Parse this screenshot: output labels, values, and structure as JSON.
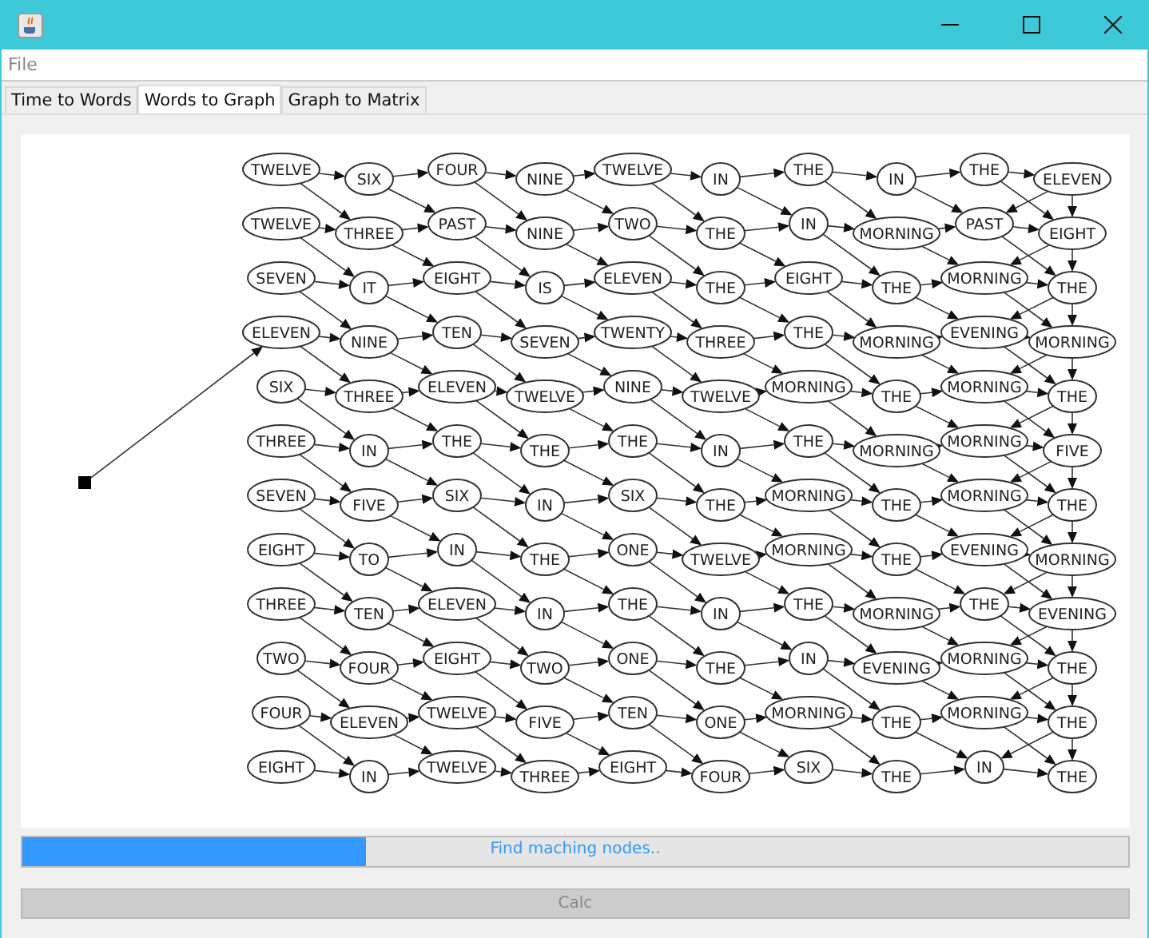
{
  "menu": [
    "File"
  ],
  "tabs": [
    {
      "label": "Time to Words",
      "selected": false
    },
    {
      "label": "Words to Graph",
      "selected": true
    },
    {
      "label": "Graph to Matrix",
      "selected": false
    }
  ],
  "graph": {
    "nodes": [
      {
        "label": "TWELVE"
      },
      {
        "label": "SIX"
      },
      {
        "label": "FOUR"
      },
      {
        "label": "NINE"
      },
      {
        "label": "TWELVE"
      },
      {
        "label": "IN"
      },
      {
        "label": "THE"
      },
      {
        "label": "IN"
      },
      {
        "label": "THE"
      },
      {
        "label": "ELEVEN"
      },
      {
        "label": "TWELVE"
      },
      {
        "label": "THREE"
      },
      {
        "label": "PAST"
      },
      {
        "label": "NINE"
      },
      {
        "label": "TWO"
      },
      {
        "label": "THE"
      },
      {
        "label": "IN"
      },
      {
        "label": "MORNING"
      },
      {
        "label": "PAST"
      },
      {
        "label": "EIGHT"
      },
      {
        "label": "SEVEN"
      },
      {
        "label": "IT"
      },
      {
        "label": "EIGHT"
      },
      {
        "label": "IS"
      },
      {
        "label": "ELEVEN"
      },
      {
        "label": "THE"
      },
      {
        "label": "EIGHT"
      },
      {
        "label": "THE"
      },
      {
        "label": "MORNING"
      },
      {
        "label": "THE"
      },
      {
        "label": "ELEVEN"
      },
      {
        "label": "NINE"
      },
      {
        "label": "TEN"
      },
      {
        "label": "SEVEN"
      },
      {
        "label": "TWENTY"
      },
      {
        "label": "THREE"
      },
      {
        "label": "THE"
      },
      {
        "label": "MORNING"
      },
      {
        "label": "EVENING"
      },
      {
        "label": "MORNING"
      },
      {
        "label": "SIX"
      },
      {
        "label": "THREE"
      },
      {
        "label": "ELEVEN"
      },
      {
        "label": "TWELVE"
      },
      {
        "label": "NINE"
      },
      {
        "label": "TWELVE"
      },
      {
        "label": "MORNING"
      },
      {
        "label": "THE"
      },
      {
        "label": "MORNING"
      },
      {
        "label": "THE"
      },
      {
        "label": "THREE"
      },
      {
        "label": "IN"
      },
      {
        "label": "THE"
      },
      {
        "label": "THE"
      },
      {
        "label": "THE"
      },
      {
        "label": "IN"
      },
      {
        "label": "THE"
      },
      {
        "label": "MORNING"
      },
      {
        "label": "MORNING"
      },
      {
        "label": "FIVE"
      },
      {
        "label": "SEVEN"
      },
      {
        "label": "FIVE"
      },
      {
        "label": "SIX"
      },
      {
        "label": "IN"
      },
      {
        "label": "SIX"
      },
      {
        "label": "THE"
      },
      {
        "label": "MORNING"
      },
      {
        "label": "THE"
      },
      {
        "label": "MORNING"
      },
      {
        "label": "THE"
      },
      {
        "label": "EIGHT"
      },
      {
        "label": "TO"
      },
      {
        "label": "IN"
      },
      {
        "label": "THE"
      },
      {
        "label": "ONE"
      },
      {
        "label": "TWELVE"
      },
      {
        "label": "MORNING"
      },
      {
        "label": "THE"
      },
      {
        "label": "EVENING"
      },
      {
        "label": "MORNING"
      },
      {
        "label": "THREE"
      },
      {
        "label": "TEN"
      },
      {
        "label": "ELEVEN"
      },
      {
        "label": "IN"
      },
      {
        "label": "THE"
      },
      {
        "label": "IN"
      },
      {
        "label": "THE"
      },
      {
        "label": "MORNING"
      },
      {
        "label": "THE"
      },
      {
        "label": "EVENING"
      },
      {
        "label": "TWO"
      },
      {
        "label": "FOUR"
      },
      {
        "label": "EIGHT"
      },
      {
        "label": "TWO"
      },
      {
        "label": "ONE"
      },
      {
        "label": "THE"
      },
      {
        "label": "IN"
      },
      {
        "label": "EVENING"
      },
      {
        "label": "MORNING"
      },
      {
        "label": "THE"
      },
      {
        "label": "FOUR"
      },
      {
        "label": "ELEVEN"
      },
      {
        "label": "TWELVE"
      },
      {
        "label": "FIVE"
      },
      {
        "label": "TEN"
      },
      {
        "label": "ONE"
      },
      {
        "label": "MORNING"
      },
      {
        "label": "THE"
      },
      {
        "label": "MORNING"
      },
      {
        "label": "THE"
      },
      {
        "label": "EIGHT"
      },
      {
        "label": "IN"
      },
      {
        "label": "TWELVE"
      },
      {
        "label": "THREE"
      },
      {
        "label": "EIGHT"
      },
      {
        "label": "FOUR"
      },
      {
        "label": "SIX"
      },
      {
        "label": "THE"
      },
      {
        "label": "IN"
      },
      {
        "label": "THE"
      }
    ]
  },
  "progress": {
    "level": 0.31,
    "text": "Find maching nodes.."
  },
  "button": {
    "label": "Calc",
    "disabled": true
  }
}
